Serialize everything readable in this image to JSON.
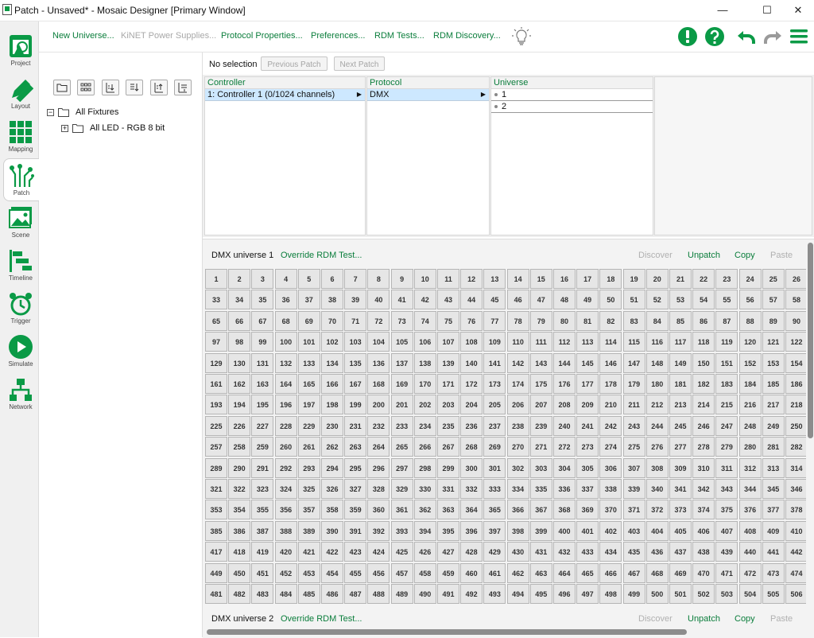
{
  "window": {
    "title": "Patch - Unsaved* - Mosaic Designer [Primary Window]",
    "minimize": "—",
    "maximize": "☐",
    "close": "✕"
  },
  "sidebar": {
    "items": [
      {
        "label": "Project",
        "icon": "project-icon"
      },
      {
        "label": "Layout",
        "icon": "layout-icon"
      },
      {
        "label": "Mapping",
        "icon": "mapping-icon"
      },
      {
        "label": "Patch",
        "icon": "patch-icon",
        "active": true
      },
      {
        "label": "Scene",
        "icon": "scene-icon"
      },
      {
        "label": "Timeline",
        "icon": "timeline-icon"
      },
      {
        "label": "Trigger",
        "icon": "trigger-icon"
      },
      {
        "label": "Simulate",
        "icon": "simulate-icon"
      },
      {
        "label": "Network",
        "icon": "network-icon"
      }
    ]
  },
  "toolbar": {
    "links": [
      {
        "label": "New Universe...",
        "enabled": true
      },
      {
        "label": "KiNET Power Supplies...",
        "enabled": false
      },
      {
        "label": "Protocol Properties...",
        "enabled": true
      },
      {
        "label": "Preferences...",
        "enabled": true
      },
      {
        "label": "RDM Tests...",
        "enabled": true
      },
      {
        "label": "RDM Discovery...",
        "enabled": true
      }
    ]
  },
  "tree": {
    "root": "All Fixtures",
    "child": "All LED - RGB 8 bit"
  },
  "patch": {
    "selection": "No selection",
    "previous": "Previous Patch",
    "next": "Next Patch"
  },
  "columns": {
    "controller": {
      "header": "Controller",
      "selected": "1: Controller 1 (0/1024 channels)"
    },
    "protocol": {
      "header": "Protocol",
      "selected": "DMX"
    },
    "universe": {
      "header": "Universe",
      "items": [
        "1",
        "2"
      ]
    }
  },
  "universes": [
    {
      "title": "DMX universe 1",
      "override": "Override RDM Test...",
      "discover": "Discover",
      "unpatch": "Unpatch",
      "copy": "Copy",
      "paste": "Paste",
      "visible_columns": 26,
      "visible_rows": 16,
      "row_stride": 32
    },
    {
      "title": "DMX universe 2",
      "override": "Override RDM Test...",
      "discover": "Discover",
      "unpatch": "Unpatch",
      "copy": "Copy",
      "paste": "Paste"
    }
  ],
  "colors": {
    "accent": "#0a7d3b",
    "brand_green": "#0a9a46",
    "selection": "#cde8ff",
    "disabled": "#a8a8a8"
  }
}
